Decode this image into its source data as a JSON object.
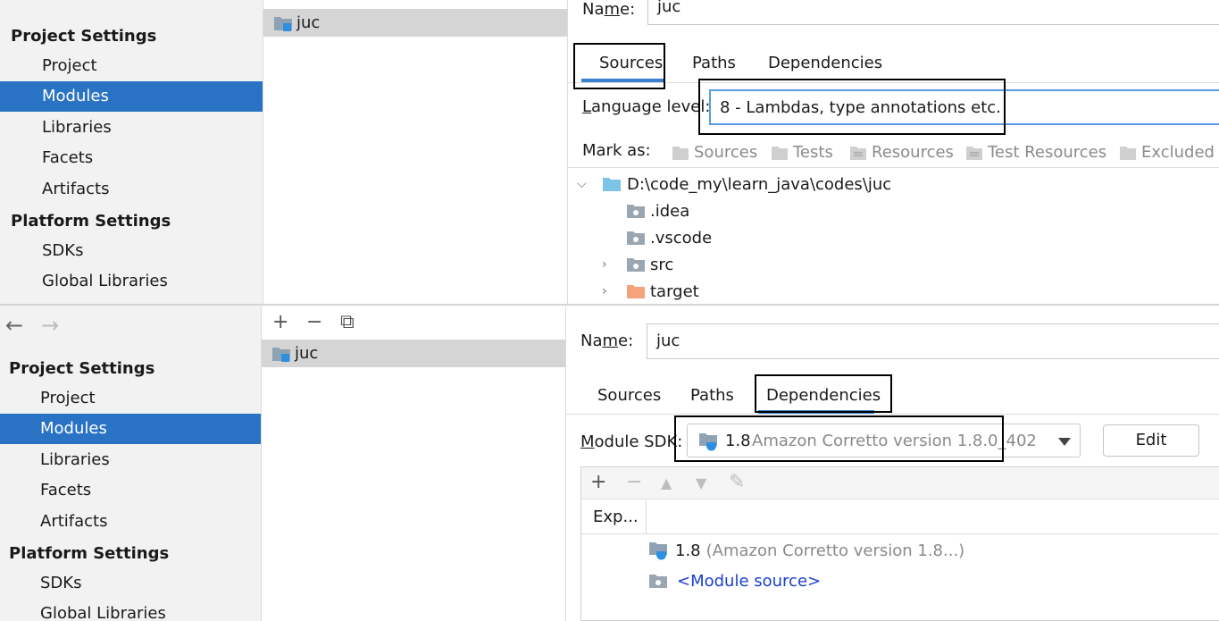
{
  "top": {
    "sidebar": {
      "project_settings": "Project Settings",
      "items": [
        "Project",
        "Modules",
        "Libraries",
        "Facets",
        "Artifacts"
      ],
      "platform_settings": "Platform Settings",
      "platform_items": [
        "SDKs",
        "Global Libraries"
      ]
    },
    "module_list": {
      "items": [
        "juc"
      ]
    },
    "detail": {
      "name_label": "Name:",
      "name_value": "juc",
      "tabs": [
        "Sources",
        "Paths",
        "Dependencies"
      ],
      "active_tab": "Sources",
      "language_level_label": "Language level:",
      "language_level_value": "8 - Lambdas, type annotations etc.",
      "mark_as_label": "Mark as:",
      "mark_as_items": [
        "Sources",
        "Tests",
        "Resources",
        "Test Resources",
        "Excluded"
      ],
      "tree": [
        {
          "label": "D:\\code_my\\learn_java\\codes\\juc",
          "expand": "down",
          "icon": "folder-blue-icon"
        },
        {
          "label": ".idea",
          "expand": "",
          "icon": "folder-gray-icon"
        },
        {
          "label": ".vscode",
          "expand": "",
          "icon": "folder-gray-icon"
        },
        {
          "label": "src",
          "expand": "right",
          "icon": "folder-gray-icon"
        },
        {
          "label": "target",
          "expand": "right",
          "icon": "folder-orange-icon"
        }
      ]
    }
  },
  "bottom": {
    "nav": {
      "back": "←",
      "forward": "→"
    },
    "sidebar": {
      "project_settings": "Project Settings",
      "items": [
        "Project",
        "Modules",
        "Libraries",
        "Facets",
        "Artifacts"
      ],
      "platform_settings": "Platform Settings",
      "platform_items": [
        "SDKs",
        "Global Libraries"
      ]
    },
    "module_toolbar": {
      "add": "+",
      "remove": "−",
      "copy": "⧉"
    },
    "module_list": {
      "items": [
        "juc"
      ]
    },
    "detail": {
      "name_label": "Name:",
      "name_value": "juc",
      "tabs": [
        "Sources",
        "Paths",
        "Dependencies"
      ],
      "active_tab": "Dependencies",
      "module_sdk_label": "Module SDK:",
      "module_sdk_version": "1.8",
      "module_sdk_desc": "Amazon Corretto version 1.8.0_402",
      "edit_button": "Edit",
      "dep_toolbar": {
        "add": "+",
        "remove": "−",
        "up": "▲",
        "down": "▼",
        "edit": "✎"
      },
      "dep_column_header": "Exp...",
      "dependencies": [
        {
          "version": "1.8",
          "desc": "(Amazon Corretto version 1.8...)"
        },
        {
          "link": "<Module source>"
        }
      ]
    }
  },
  "colors": {
    "selection": "#2a73c4",
    "tab_underline": "#3b7fd1",
    "link": "#1a3fd0",
    "sidebar_bg": "#f2f2f2",
    "module_row_bg": "#d5d5d5"
  }
}
